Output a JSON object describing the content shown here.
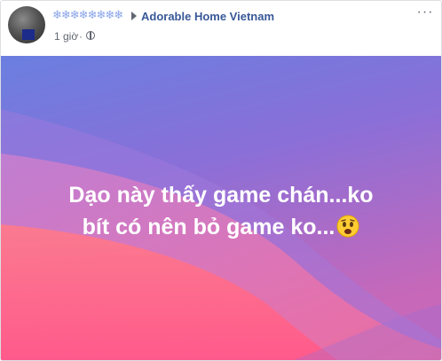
{
  "post": {
    "author_name": "❄❄❄❄❄❄❄❄",
    "group_name": "Adorable Home Vietnam",
    "time": "1 giờ",
    "separator": "·",
    "audience_icon": "globe-icon",
    "more_label": "···",
    "text_line1": "Dạo này thấy game chán...ko",
    "text_line2": "bít có nên bỏ game ko...",
    "emoji": "worried-face-icon",
    "colors": {
      "gradient_top": "#6e7be0",
      "gradient_bottom": "#f75b8a",
      "link": "#385898",
      "text": "#ffffff"
    }
  }
}
